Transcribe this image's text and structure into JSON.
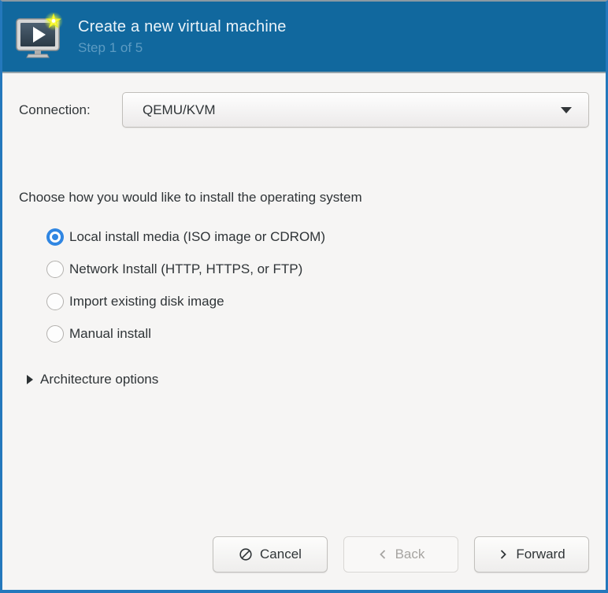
{
  "window": {
    "title": "Create a new virtual machine",
    "subtitle": "Step 1 of 5"
  },
  "connection": {
    "label": "Connection:",
    "value": "QEMU/KVM"
  },
  "install": {
    "prompt": "Choose how you would like to install the operating system",
    "options": [
      {
        "label": "Local install media (ISO image or CDROM)",
        "selected": true
      },
      {
        "label": "Network Install (HTTP, HTTPS, or FTP)",
        "selected": false
      },
      {
        "label": "Import existing disk image",
        "selected": false
      },
      {
        "label": "Manual install",
        "selected": false
      }
    ]
  },
  "expander": {
    "label": "Architecture options",
    "expanded": false
  },
  "buttons": {
    "cancel": {
      "label": "Cancel",
      "enabled": true
    },
    "back": {
      "label": "Back",
      "enabled": false
    },
    "forward": {
      "label": "Forward",
      "enabled": true
    }
  },
  "icons": {
    "app": "vm-monitor-with-new-star",
    "dropdown": "caret-down",
    "expander": "triangle-right",
    "cancel": "slashed-circle ⊘",
    "back": "chevron-left ‹",
    "forward": "chevron-right ›"
  },
  "colors": {
    "header_bg": "#11689e",
    "window_border": "#2478bc",
    "body_bg": "#f6f5f4",
    "radio_accent": "#3086e2",
    "subtitle_text": "#5c9bc2"
  }
}
